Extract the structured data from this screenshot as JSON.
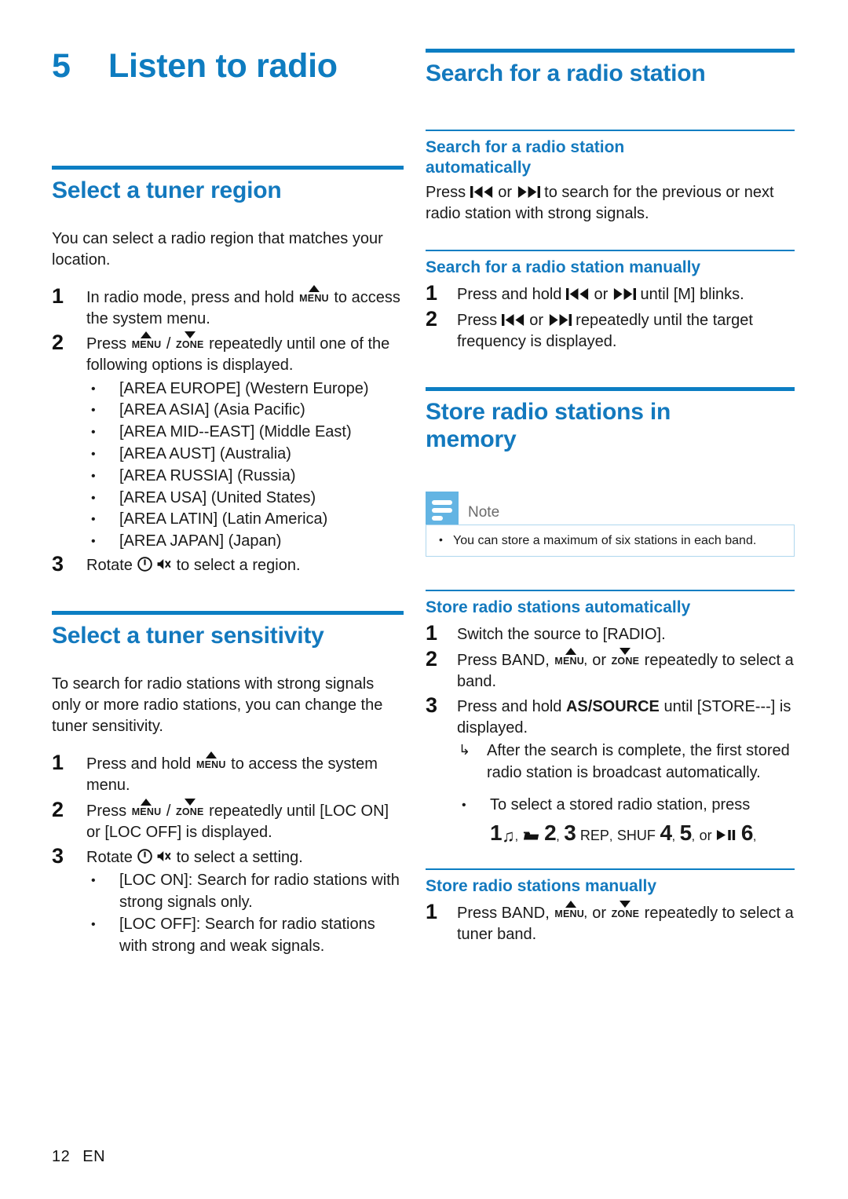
{
  "chapter": {
    "number": "5",
    "title": "Listen to radio"
  },
  "footer": {
    "page_number": "12",
    "language": "EN"
  },
  "left_column": {
    "section1": {
      "heading": "Select a tuner region",
      "intro": "You can select a radio region that matches your location.",
      "steps": [
        {
          "num": "1",
          "parts": [
            "In radio mode, press and hold ",
            "MENU",
            " to access the system menu."
          ]
        },
        {
          "num": "2",
          "parts": [
            "Press ",
            "MENU",
            " / ",
            "ZONE",
            " repeatedly until one of the following options is displayed."
          ]
        },
        {
          "num": "3",
          "parts": [
            "Rotate ",
            "power-icon",
            " ",
            "mute-icon",
            " to select a region."
          ]
        }
      ],
      "step1_a": "In radio mode, press and hold",
      "step1_b": "to access the system menu.",
      "menu_label": "MENU",
      "zone_label": "ZONE",
      "step2_a": "Press",
      "step2_sep": "/",
      "step2_b": "repeatedly until one of the following options is displayed.",
      "step3_a": "Rotate",
      "step3_b": "to select a region.",
      "areas": [
        {
          "code": "[AREA EUROPE]",
          "desc": "(Western Europe)"
        },
        {
          "code": "[AREA ASIA]",
          "desc": "(Asia Pacific)"
        },
        {
          "code": "[AREA MID--EAST]",
          "desc": "(Middle East)"
        },
        {
          "code": "[AREA AUST]",
          "desc": "(Australia)"
        },
        {
          "code": "[AREA RUSSIA]",
          "desc": "(Russia)"
        },
        {
          "code": "[AREA USA]",
          "desc": "(United States)"
        },
        {
          "code": "[AREA LATIN]",
          "desc": "(Latin America)"
        },
        {
          "code": "[AREA JAPAN]",
          "desc": "(Japan)"
        }
      ]
    },
    "section2": {
      "heading": "Select a tuner sensitivity",
      "intro": "To search for radio stations with strong signals only or more radio stations, you can change the tuner sensitivity.",
      "step1_a": "Press and hold",
      "step1_b": "to access the system menu.",
      "step2_a": "Press",
      "step2_sep": "/",
      "step2_b": "repeatedly until [LOC ON] or [LOC OFF] is displayed.",
      "step3_a": "Rotate",
      "step3_b": "to select a setting.",
      "options": [
        {
          "code": "[LOC ON]",
          "desc": ": Search for radio stations with strong signals only."
        },
        {
          "code": "[LOC OFF]",
          "desc": ": Search for radio stations with strong and weak signals."
        }
      ]
    }
  },
  "right_column": {
    "section1": {
      "heading": "Search for a radio station",
      "sub1": {
        "heading_line1": "Search for a radio station",
        "heading_line2": "automatically",
        "text_a": "Press",
        "text_or": "or",
        "text_b": "to search for the previous or next radio station with strong signals."
      },
      "sub2": {
        "heading": "Search for a radio station manually",
        "step1_a": "Press and hold",
        "step1_or": "or",
        "step1_b": "until [M] blinks.",
        "step2_a": "Press",
        "step2_or": "or",
        "step2_b": "repeatedly until the target frequency is displayed."
      }
    },
    "section2": {
      "heading_line1": "Store radio stations in",
      "heading_line2": "memory",
      "note": {
        "label": "Note",
        "items": [
          "You can store a maximum of six stations in each band."
        ]
      },
      "sub1": {
        "heading": "Store radio stations automatically",
        "step1": "Switch the source to [RADIO].",
        "step2_a": "Press BAND,",
        "step2_menu": "MENU,",
        "step2_or": "or",
        "step2_zone": "ZONE",
        "step2_b": "repeatedly to select a band.",
        "step3_a": "Press and hold",
        "step3_kbd": "AS/SOURCE",
        "step3_b": "until [STORE---] is displayed.",
        "arrow_item": "After the search is complete, the first stored radio station is broadcast automatically.",
        "bullet_item": "To select a stored radio station, press",
        "presets": {
          "p1": "1",
          "music_icon": "music-note-icon",
          "folder_icon": "folder-icon",
          "p2": "2",
          "p3": "3",
          "rep": "REP",
          "shuf": "SHUF",
          "p4": "4",
          "p5": "5",
          "or": "or",
          "playpause_icon": "play-pause-icon",
          "p6": "6",
          "comma": ","
        }
      },
      "sub2": {
        "heading": "Store radio stations manually",
        "step1_a": "Press BAND,",
        "step1_menu": "MENU,",
        "step1_or": "or",
        "step1_zone": "ZONE",
        "step1_b": "repeatedly to select a tuner band."
      }
    }
  },
  "colors": {
    "brand_blue": "#1379BE",
    "rule_blue": "#0C7EC3",
    "note_icon_blue": "#63B4E3",
    "note_border": "#AFD7EE"
  }
}
